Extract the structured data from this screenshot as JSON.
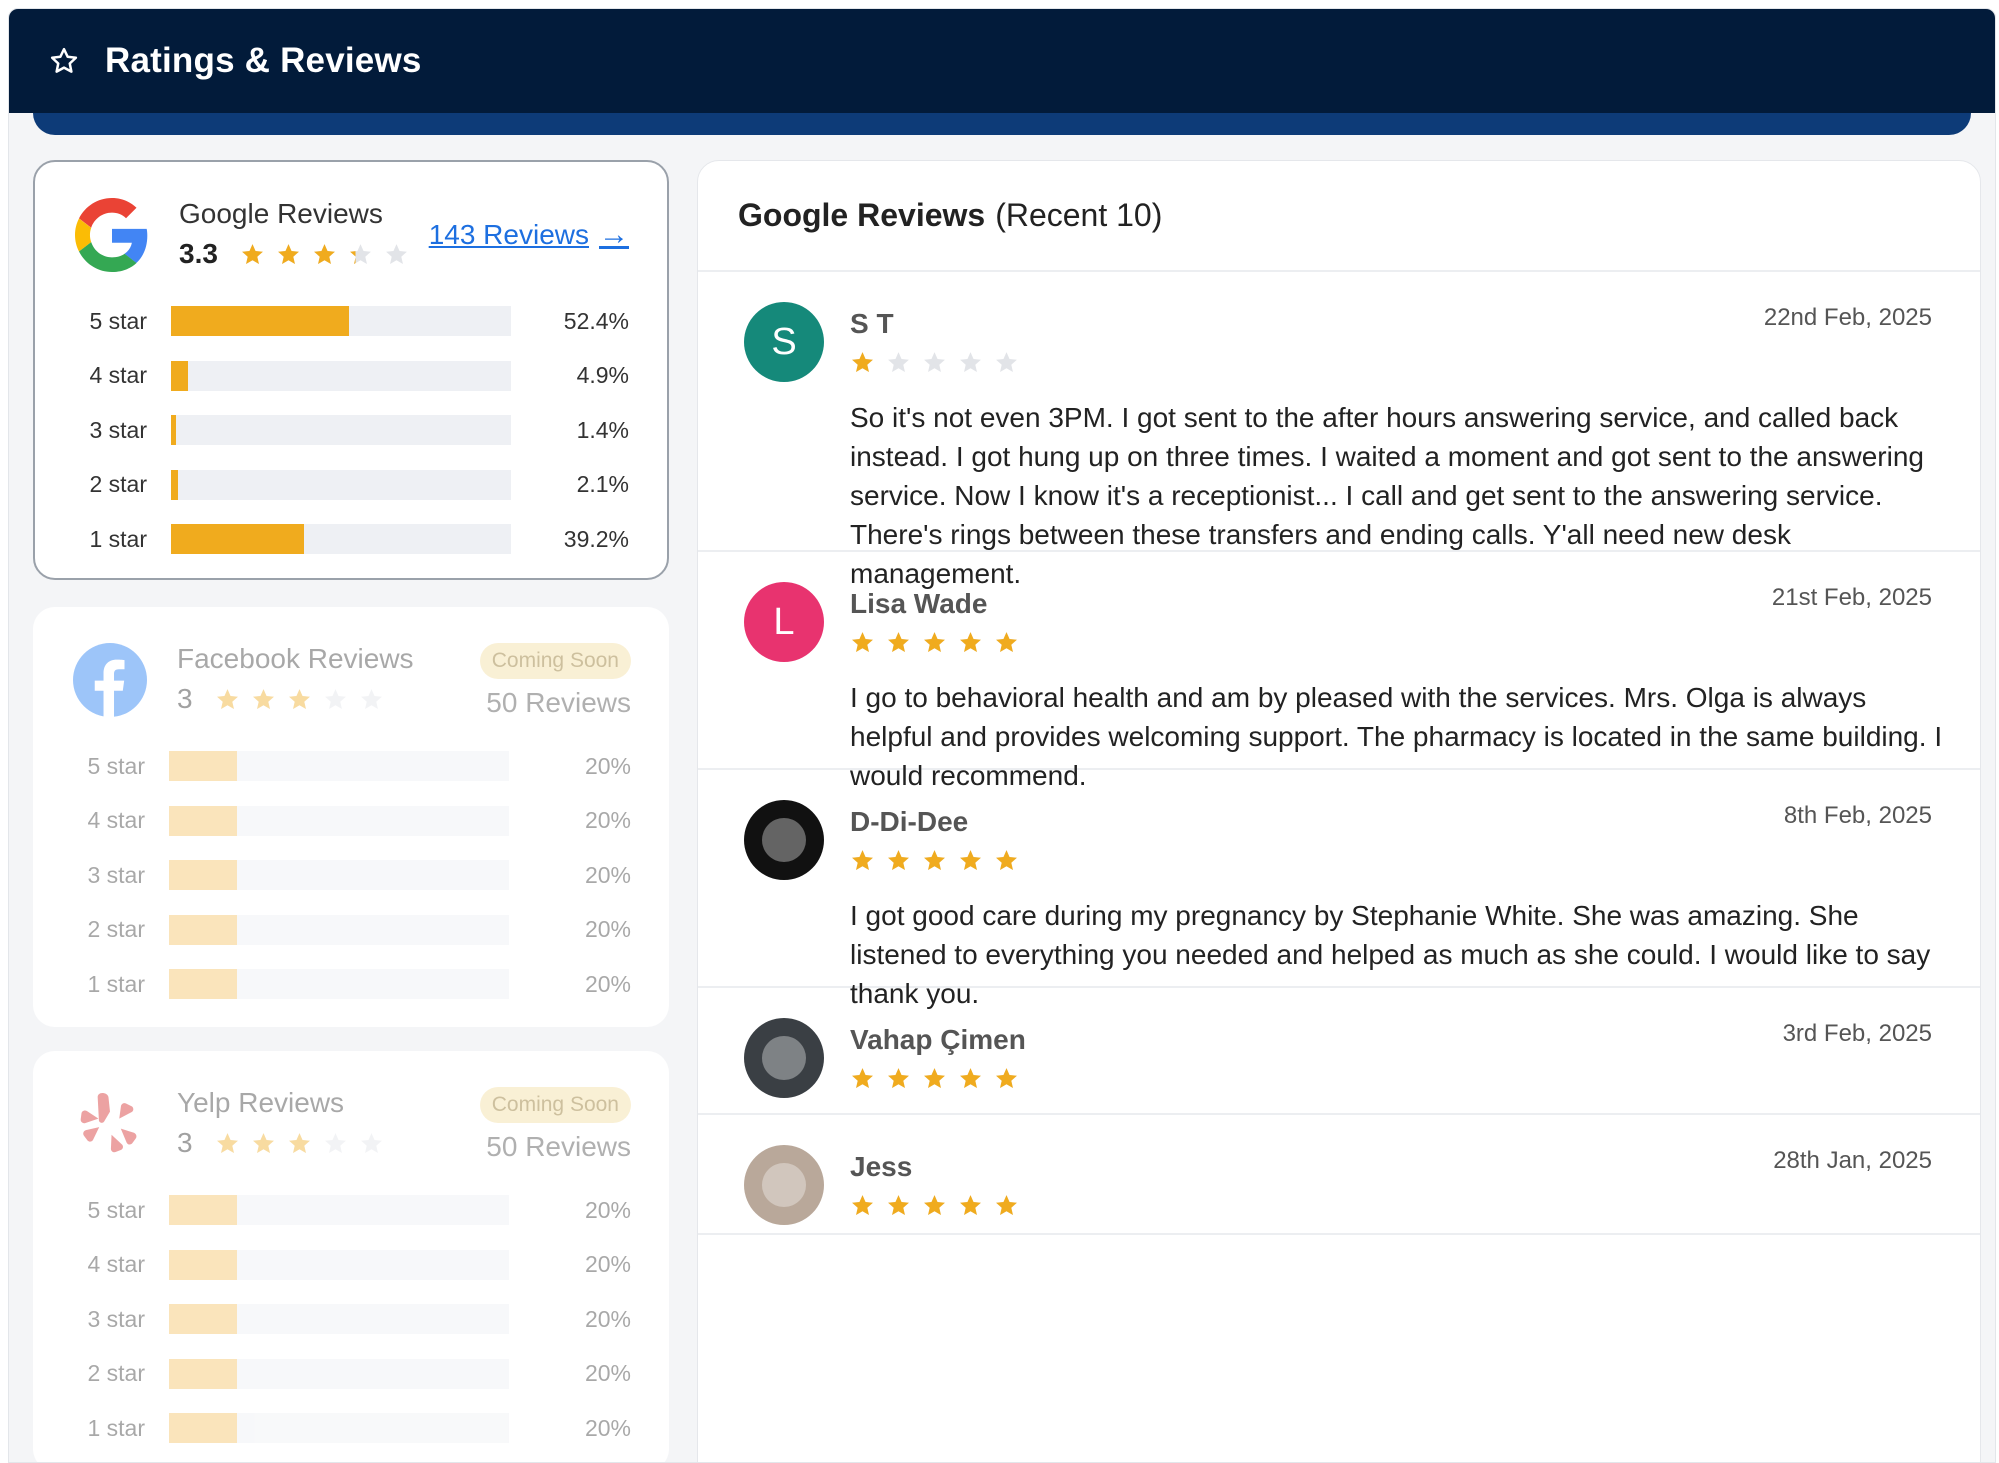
{
  "header": {
    "title": "Ratings & Reviews",
    "icon": "star-outline-icon"
  },
  "colors": {
    "star": "#f0ab1e",
    "star_empty": "#e2e4e8",
    "header_bg": "#021b3a",
    "link": "#1d6fe0"
  },
  "google": {
    "name": "Google Reviews",
    "rating_text": "3.3",
    "rating": 3.3,
    "link_label": "143 Reviews",
    "rows": [
      {
        "label": "5 star",
        "pct_text": "52.4%",
        "pct": 52.4
      },
      {
        "label": "4 star",
        "pct_text": "4.9%",
        "pct": 4.9
      },
      {
        "label": "3 star",
        "pct_text": "1.4%",
        "pct": 1.4
      },
      {
        "label": "2 star",
        "pct_text": "2.1%",
        "pct": 2.1
      },
      {
        "label": "1 star",
        "pct_text": "39.2%",
        "pct": 39.2
      }
    ]
  },
  "facebook": {
    "name": "Facebook Reviews",
    "rating_text": "3",
    "rating": 3,
    "badge": "Coming Soon",
    "count": "50 Reviews",
    "rows": [
      {
        "label": "5 star",
        "pct_text": "20%",
        "pct": 20
      },
      {
        "label": "4 star",
        "pct_text": "20%",
        "pct": 20
      },
      {
        "label": "3 star",
        "pct_text": "20%",
        "pct": 20
      },
      {
        "label": "2 star",
        "pct_text": "20%",
        "pct": 20
      },
      {
        "label": "1 star",
        "pct_text": "20%",
        "pct": 20
      }
    ]
  },
  "yelp": {
    "name": "Yelp Reviews",
    "rating_text": "3",
    "rating": 3,
    "badge": "Coming Soon",
    "count": "50 Reviews",
    "rows": [
      {
        "label": "5 star",
        "pct_text": "20%",
        "pct": 20
      },
      {
        "label": "4 star",
        "pct_text": "20%",
        "pct": 20
      },
      {
        "label": "3 star",
        "pct_text": "20%",
        "pct": 20
      },
      {
        "label": "2 star",
        "pct_text": "20%",
        "pct": 20
      },
      {
        "label": "1 star",
        "pct_text": "20%",
        "pct": 20
      }
    ]
  },
  "panel": {
    "title_bold": "Google Reviews",
    "title_rest": "(Recent 10)",
    "reviews": [
      {
        "initial": "S",
        "avatar_color": "#15897a",
        "name": "S T",
        "date": "22nd Feb, 2025",
        "rating": 1,
        "text": "So it's not even 3PM. I got sent to the after hours answering service, and called back instead. I got hung up on three times. I waited a moment and got sent to the answering service. Now I know it's a receptionist... I call and get sent to the answering service. There's rings between these transfers and ending calls. Y'all need new desk management."
      },
      {
        "initial": "L",
        "avatar_color": "#e8336f",
        "name": "Lisa Wade",
        "date": "21st Feb, 2025",
        "rating": 5,
        "text": "I go to behavioral health and am by pleased with the services. Mrs. Olga is always helpful and provides welcoming support. The pharmacy is located in the same building. I would recommend."
      },
      {
        "initial": "",
        "avatar_color": "#111111",
        "name": "D-Di-Dee",
        "date": "8th Feb, 2025",
        "rating": 5,
        "text": "I got good care during my pregnancy by Stephanie White. She was amazing. She listened to everything you needed and helped as much as she could. I would like to say thank you."
      },
      {
        "initial": "",
        "avatar_color": "#3a3f44",
        "name": "Vahap Çimen",
        "date": "3rd Feb, 2025",
        "rating": 5,
        "text": ""
      },
      {
        "initial": "",
        "avatar_color": "#b9a89a",
        "name": "Jess",
        "date": "28th Jan, 2025",
        "rating": 5,
        "text": ""
      }
    ]
  }
}
